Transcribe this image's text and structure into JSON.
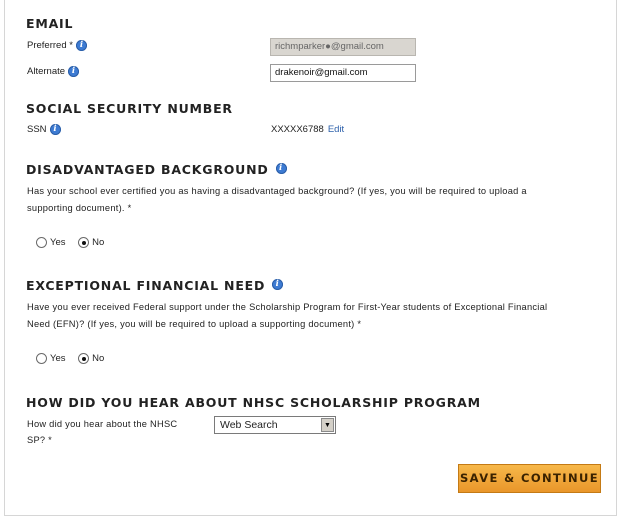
{
  "email": {
    "title": "EMAIL",
    "preferred_label": "Preferred *",
    "preferred_value": "richmparker●@gmail.com",
    "alternate_label": "Alternate",
    "alternate_value": "drakenoir@gmail.com"
  },
  "ssn": {
    "title": "SOCIAL SECURITY NUMBER",
    "label": "SSN",
    "value": "XXXXX6788",
    "edit_label": "Edit"
  },
  "disadvantaged": {
    "title": "DISADVANTAGED BACKGROUND",
    "question_line1": "Has your school ever certified you as having a disadvantaged background? (If yes, you will be required to upload a",
    "question_line2": "supporting document). *",
    "yes_label": "Yes",
    "no_label": "No",
    "selected": "No"
  },
  "financial": {
    "title": "EXCEPTIONAL FINANCIAL NEED",
    "question_line1": "Have you ever received Federal support under the Scholarship Program for First-Year students of Exceptional Financial",
    "question_line2": "Need (EFN)? (If yes, you will be required to upload a supporting document) *",
    "yes_label": "Yes",
    "no_label": "No",
    "selected": "No"
  },
  "hear": {
    "title": "HOW DID YOU HEAR ABOUT NHSC SCHOLARSHIP PROGRAM",
    "label_line1": "How did you hear about the NHSC",
    "label_line2": "SP? *",
    "selected": "Web Search"
  },
  "actions": {
    "continue_label": "SAVE & CONTINUE"
  },
  "colors": {
    "button": "#f0a63a",
    "link": "#2b5faa",
    "info_icon": "#3d7bd3"
  }
}
